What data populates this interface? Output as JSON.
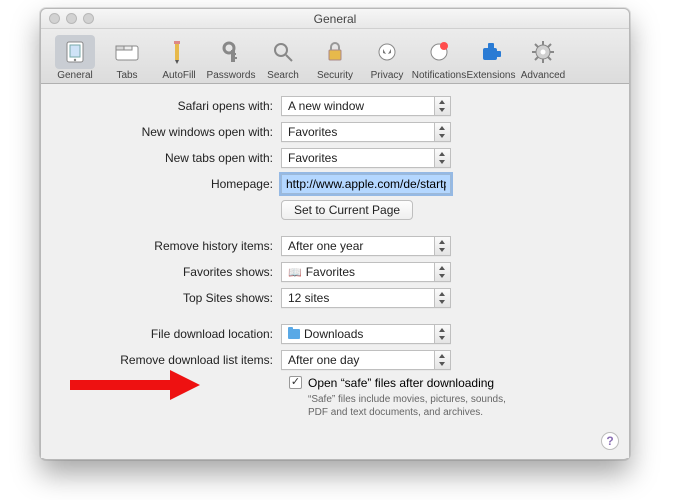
{
  "window": {
    "title": "General"
  },
  "toolbar": {
    "items": [
      {
        "label": "General",
        "icon": "general",
        "selected": true
      },
      {
        "label": "Tabs",
        "icon": "tabs",
        "selected": false
      },
      {
        "label": "AutoFill",
        "icon": "autofill",
        "selected": false
      },
      {
        "label": "Passwords",
        "icon": "passwords",
        "selected": false
      },
      {
        "label": "Search",
        "icon": "search",
        "selected": false
      },
      {
        "label": "Security",
        "icon": "security",
        "selected": false
      },
      {
        "label": "Privacy",
        "icon": "privacy",
        "selected": false
      },
      {
        "label": "Notifications",
        "icon": "notifications",
        "selected": false
      },
      {
        "label": "Extensions",
        "icon": "extensions",
        "selected": false
      },
      {
        "label": "Advanced",
        "icon": "advanced",
        "selected": false
      }
    ]
  },
  "labels": {
    "opens_with": "Safari opens with:",
    "new_windows": "New windows open with:",
    "new_tabs": "New tabs open with:",
    "homepage": "Homepage:",
    "set_current": "Set to Current Page",
    "remove_hist": "Remove history items:",
    "fav_shows": "Favorites shows:",
    "top_sites": "Top Sites shows:",
    "dl_location": "File download location:",
    "dl_list": "Remove download list items:",
    "safe_title": "Open “safe” files after downloading",
    "safe_desc": "“Safe” files include movies, pictures, sounds, PDF and text documents, and archives."
  },
  "values": {
    "opens_with": "A new window",
    "new_windows": "Favorites",
    "new_tabs": "Favorites",
    "homepage": "http://www.apple.com/de/startpag",
    "remove_hist": "After one year",
    "fav_shows": "Favorites",
    "top_sites": "12 sites",
    "dl_location": "Downloads",
    "dl_list": "After one day",
    "safe_checked": true
  }
}
